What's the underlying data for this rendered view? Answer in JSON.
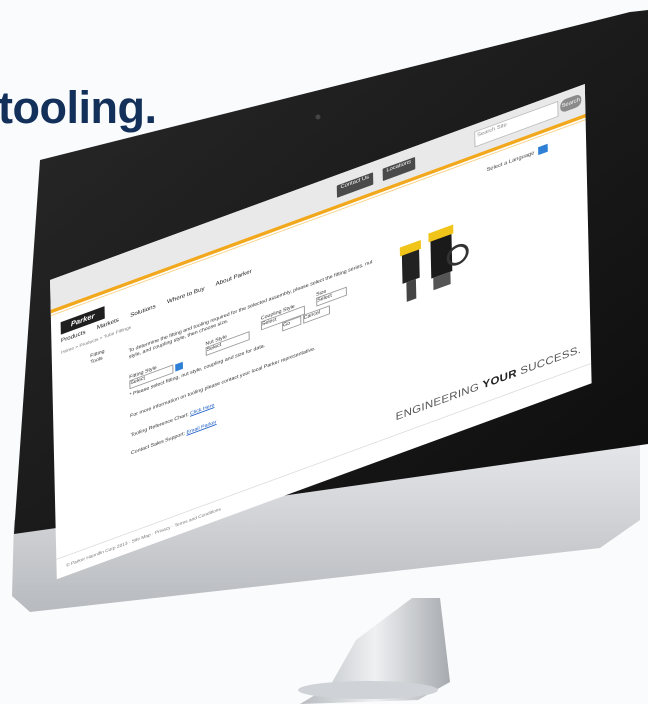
{
  "headline": "tooling.",
  "site": {
    "utility_buttons": [
      "Contact Us",
      "Locations"
    ],
    "search_placeholder": "Search Site",
    "search_button": "Search",
    "logo_text": "Parker",
    "nav_items": [
      "Products",
      "Markets",
      "Solutions",
      "Where to Buy",
      "About Parker"
    ],
    "language_label": "Select a Language",
    "breadcrumb": "Home > Products > Tube Fittings",
    "left_labels": [
      "Fitting",
      "Tools"
    ],
    "intro_text": "To determine the fitting and tooling required for the selected assembly, please select the fitting series, nut style, and coupling style, then choose size.",
    "field_labels": {
      "fitting": "Fitting Style",
      "nut": "Nut Style",
      "coupling": "Coupling Style",
      "size": "Size"
    },
    "field_values": {
      "fitting": "Select",
      "nut": "Select",
      "coupling": "Select",
      "size": "Select"
    },
    "submit_label": "Go",
    "reset_label": "Cancel",
    "note": "* Please select fitting, nut style, coupling and size for data.",
    "help_text": "For more information on tooling please contact your local Parker representative.",
    "chart_link_label": "Tooling Reference Chart:",
    "chart_link": "Click Here",
    "contact_label": "Contact Sales Support:",
    "contact_link": "Email Parker",
    "tagline_normal": "ENGINEERING ",
    "tagline_bold": "YOUR",
    "tagline_end": " SUCCESS.",
    "footer": "© Parker Hannifin Corp 2013 · Site Map · Privacy · Terms and Conditions"
  },
  "colors": {
    "accent": "#f2a81d",
    "navy": "#12305a",
    "link": "#1a5bc4"
  }
}
